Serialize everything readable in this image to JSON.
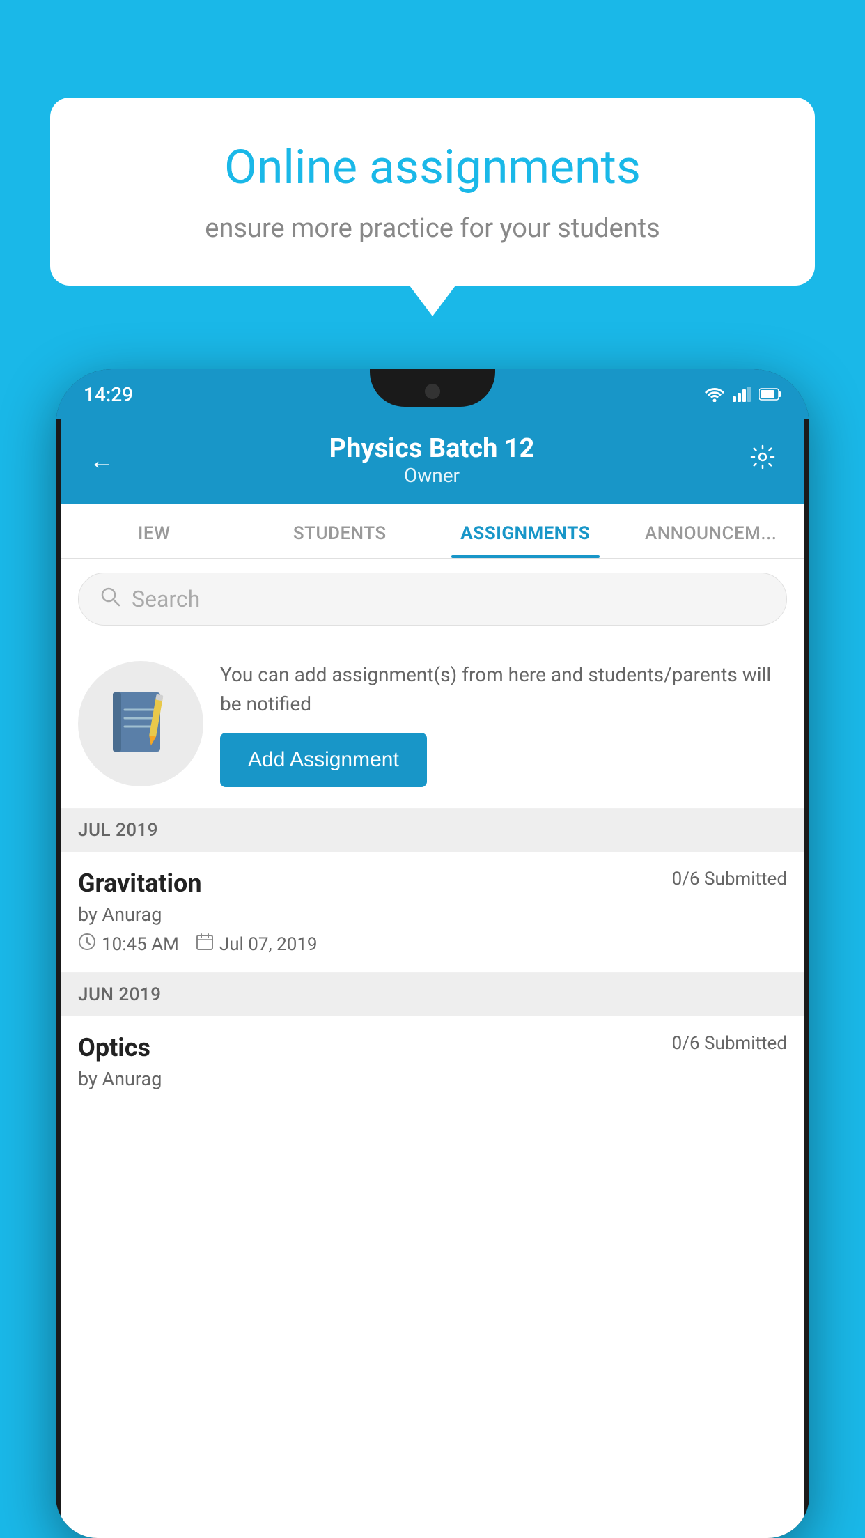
{
  "background_color": "#1ab8e8",
  "speech_bubble": {
    "title": "Online assignments",
    "subtitle": "ensure more practice for your students"
  },
  "phone": {
    "status_bar": {
      "time": "14:29",
      "icons": [
        "wifi",
        "signal",
        "battery"
      ]
    },
    "header": {
      "title": "Physics Batch 12",
      "subtitle": "Owner",
      "back_label": "←",
      "settings_label": "⚙"
    },
    "tabs": [
      {
        "label": "IEW",
        "active": false
      },
      {
        "label": "STUDENTS",
        "active": false
      },
      {
        "label": "ASSIGNMENTS",
        "active": true
      },
      {
        "label": "ANNOUNCEM...",
        "active": false
      }
    ],
    "search": {
      "placeholder": "Search"
    },
    "promo": {
      "description": "You can add assignment(s) from here and students/parents will be notified",
      "button_label": "Add Assignment"
    },
    "sections": [
      {
        "month_label": "JUL 2019",
        "assignments": [
          {
            "title": "Gravitation",
            "submitted": "0/6 Submitted",
            "author": "by Anurag",
            "time": "10:45 AM",
            "date": "Jul 07, 2019"
          }
        ]
      },
      {
        "month_label": "JUN 2019",
        "assignments": [
          {
            "title": "Optics",
            "submitted": "0/6 Submitted",
            "author": "by Anurag",
            "time": "",
            "date": ""
          }
        ]
      }
    ]
  }
}
